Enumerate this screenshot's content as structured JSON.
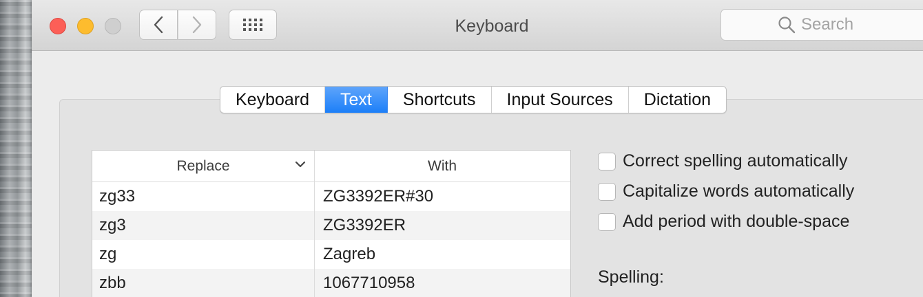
{
  "window": {
    "title": "Keyboard"
  },
  "search": {
    "placeholder": "Search"
  },
  "tabs": [
    {
      "label": "Keyboard",
      "active": false
    },
    {
      "label": "Text",
      "active": true
    },
    {
      "label": "Shortcuts",
      "active": false
    },
    {
      "label": "Input Sources",
      "active": false
    },
    {
      "label": "Dictation",
      "active": false
    }
  ],
  "table": {
    "headers": {
      "replace": "Replace",
      "with": "With"
    },
    "rows": [
      {
        "replace": "zg33",
        "with": "ZG3392ER#30"
      },
      {
        "replace": "zg3",
        "with": "ZG3392ER"
      },
      {
        "replace": "zg",
        "with": "Zagreb"
      },
      {
        "replace": "zbb",
        "with": "1067710958"
      }
    ]
  },
  "options": [
    {
      "label": "Correct spelling automatically",
      "checked": false
    },
    {
      "label": "Capitalize words automatically",
      "checked": false
    },
    {
      "label": "Add period with double-space",
      "checked": false
    }
  ],
  "spelling": {
    "label": "Spelling:"
  },
  "colors": {
    "accent": "#1c7ff8",
    "close": "#fc5f57",
    "minimize": "#fdbc2e"
  },
  "icons": [
    "back-chevron-icon",
    "forward-chevron-icon",
    "grid-icon",
    "search-icon",
    "chevron-down-icon"
  ]
}
